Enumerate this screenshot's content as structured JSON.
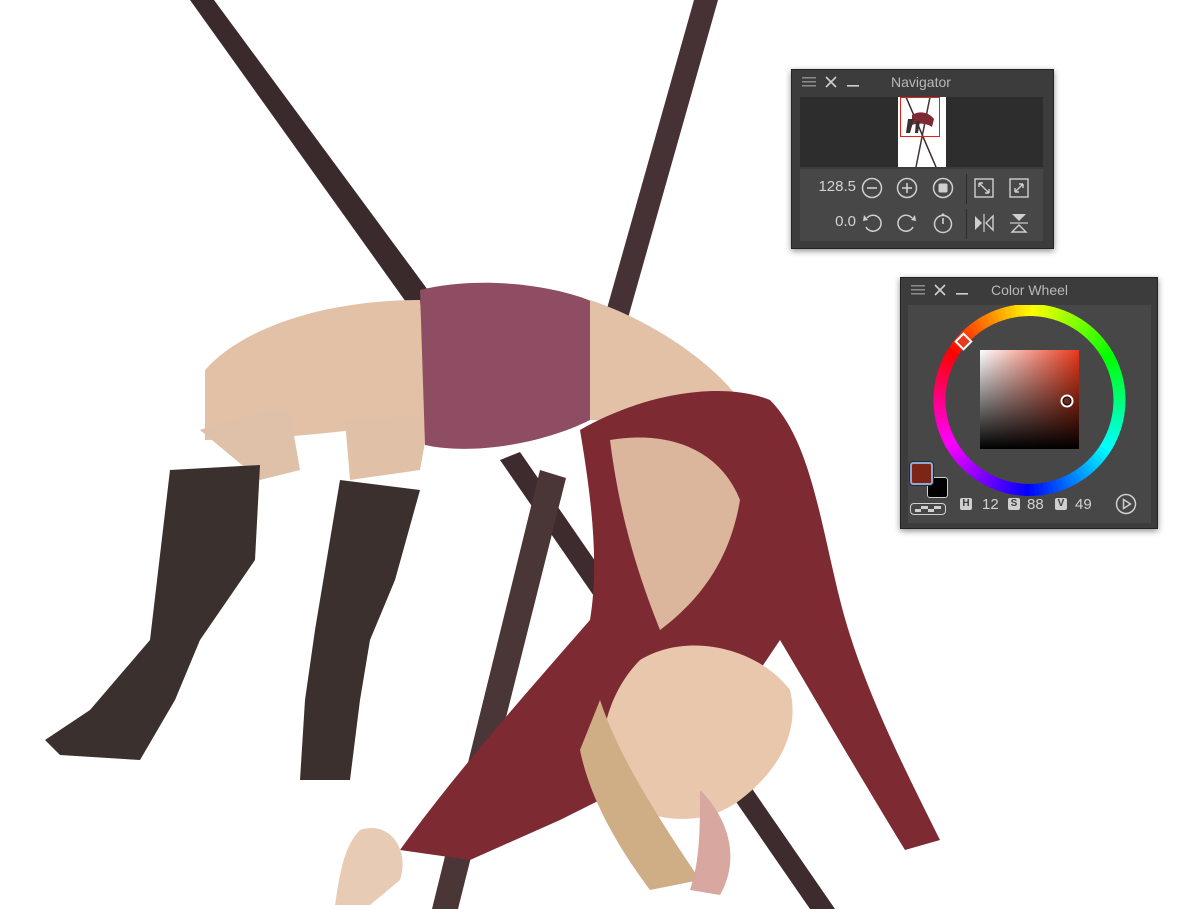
{
  "navigator": {
    "title": "Navigator",
    "zoom_value": "128.5",
    "rotation_value": "0.0",
    "icons": {
      "menu": "menu-icon",
      "close": "close-icon",
      "minimize": "minimize-icon",
      "zoom_out": "zoom-out-icon",
      "zoom_in": "zoom-in-icon",
      "zoom_actual": "actual-size-icon",
      "fit_view": "fit-to-view-icon",
      "fill_view": "fill-view-icon",
      "rotate_left": "rotate-left-icon",
      "rotate_right": "rotate-right-icon",
      "reset_rotation": "reset-rotation-icon",
      "flip_horizontal": "flip-horizontal-icon",
      "flip_vertical": "flip-vertical-icon"
    }
  },
  "color_wheel": {
    "title": "Color Wheel",
    "h_label": "H",
    "h_value": "12",
    "s_label": "S",
    "s_value": "88",
    "v_label": "V",
    "v_value": "49",
    "main_color": "#7d2615",
    "sub_color": "#000000",
    "hue_color": "#e8381b",
    "icons": {
      "menu": "menu-icon",
      "close": "close-icon",
      "minimize": "minimize-icon",
      "transparent": "transparent-color-icon",
      "expand": "play-icon"
    }
  },
  "colors": {
    "panel_bg": "#3c3c3c",
    "panel_body": "#474747",
    "thumb_area": "#2d2d2d",
    "canvas": "#ffffff",
    "viewbox_border": "#e0241a"
  }
}
